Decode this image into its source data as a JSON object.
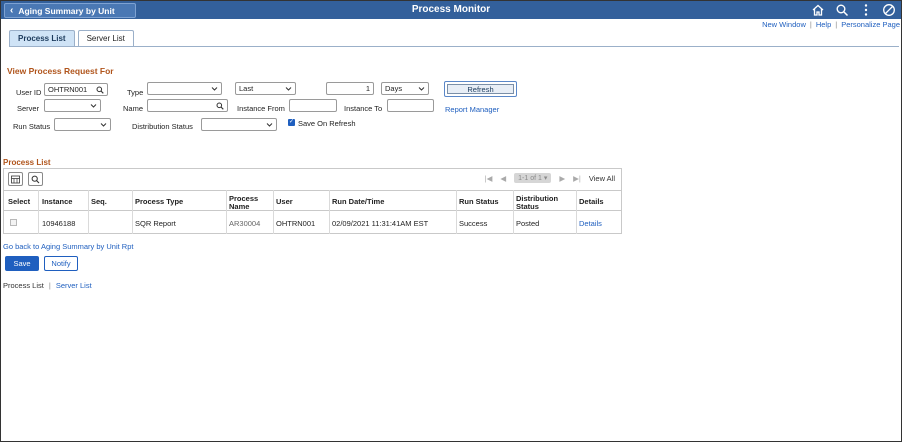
{
  "header": {
    "back_label": "Aging Summary by Unit",
    "title": "Process Monitor",
    "icons": [
      "home-icon",
      "search-icon",
      "kebab-menu-icon",
      "no-entry-icon"
    ]
  },
  "top_links": {
    "new_window": "New Window",
    "help": "Help",
    "personalize": "Personalize Page"
  },
  "tabs": [
    {
      "label": "Process List",
      "active": true
    },
    {
      "label": "Server List",
      "active": false
    }
  ],
  "form": {
    "section_title": "View Process Request For",
    "user_id_label": "User ID",
    "user_id_value": "OHTRN001",
    "type_label": "Type",
    "type_value": "",
    "last_value": "Last",
    "count_value": "1",
    "unit_value": "Days",
    "refresh_label": "Refresh",
    "server_label": "Server",
    "server_value": "",
    "name_label": "Name",
    "name_value": "",
    "instance_from_label": "Instance From",
    "instance_from_value": "",
    "instance_to_label": "Instance To",
    "instance_to_value": "",
    "report_manager_label": "Report Manager",
    "run_status_label": "Run Status",
    "run_status_value": "",
    "distribution_status_label": "Distribution Status",
    "distribution_status_value": "",
    "save_on_refresh_label": "Save On Refresh",
    "save_on_refresh_checked": true
  },
  "process_list": {
    "title": "Process List",
    "pager_range": "1-1 of 1",
    "view_all": "View All",
    "columns": [
      "Select",
      "Instance",
      "Seq.",
      "Process Type",
      "Process Name",
      "User",
      "Run Date/Time",
      "Run Status",
      "Distribution Status",
      "Details"
    ],
    "rows": [
      {
        "instance": "10946188",
        "seq": "",
        "process_type": "SQR Report",
        "process_name": "AR30004",
        "user": "OHTRN001",
        "run_datetime": "02/09/2021 11:31:41AM EST",
        "run_status": "Success",
        "distribution_status": "Posted",
        "details": "Details"
      }
    ]
  },
  "footer": {
    "go_back_link": "Go back to Aging Summary by Unit Rpt",
    "save_label": "Save",
    "notify_label": "Notify",
    "nav_process_list": "Process List",
    "nav_separator": "|",
    "nav_server_list": "Server List"
  },
  "colors": {
    "header_bg": "#33609b",
    "accent": "#1f5fbf",
    "section_title": "#b0541b"
  }
}
